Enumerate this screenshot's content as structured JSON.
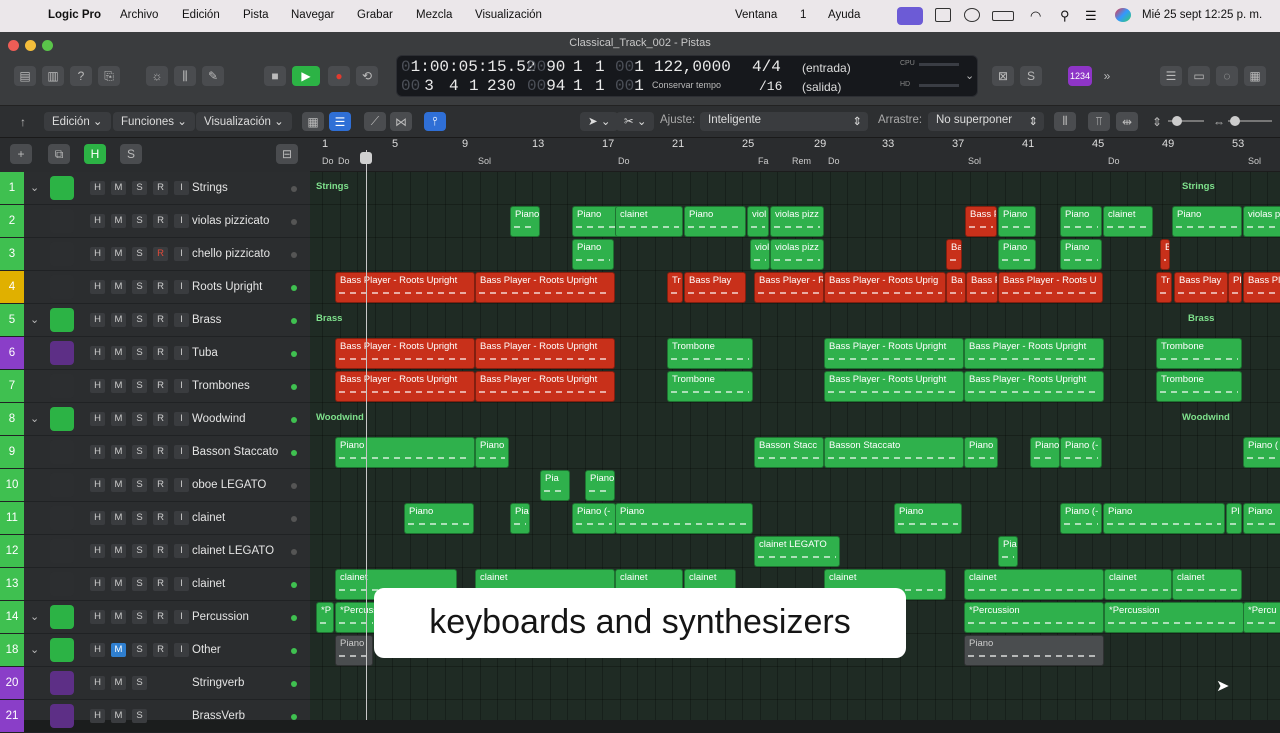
{
  "menubar": {
    "app": "Logic Pro",
    "items": [
      "Archivo",
      "Edición",
      "Pista",
      "Navegar",
      "Grabar",
      "Mezcla",
      "Visualización"
    ],
    "right_items": [
      "Ventana",
      "1",
      "Ayuda"
    ],
    "clock": "Mié 25 sept  12:25 p. m."
  },
  "window": {
    "title": "Classical_Track_002 - Pistas"
  },
  "lcd": {
    "time_dim": "0",
    "time": "1:00:05:15.52",
    "bars_dim": "00",
    "bars_1": "90",
    "b1": "1",
    "b2": "1",
    "ticks_dim": "00",
    "ticks": "1",
    "pos2_dim": "00",
    "pos2_a": "3",
    "pos2_b": "4",
    "pos2_c": "1",
    "pos2_d": "230",
    "end_dim": "00",
    "end_a": "94",
    "end_b": "1",
    "end_c": "1",
    "end_tdim": "00",
    "end_t": "1",
    "tempo": "122,0000",
    "tempo_label": "Conservar tempo",
    "sig": "4/4",
    "div": "/16",
    "in": "(entrada)",
    "out": "(salida)",
    "cpu": "CPU",
    "hd": "HD",
    "badge": "1234"
  },
  "control": {
    "edit": "Edición",
    "functions": "Funciones",
    "view": "Visualización",
    "snap_label": "Ajuste:",
    "snap": "Inteligente",
    "drag_label": "Arrastre:",
    "drag": "No superponer"
  },
  "track_header": {
    "h": "H",
    "s": "S"
  },
  "tracks": [
    {
      "num": "1",
      "name": "Strings",
      "folder": true,
      "color": "#3fc050",
      "led": "#555"
    },
    {
      "num": "2",
      "name": "violas pizzicato",
      "color": "#3fc050",
      "led": "#555"
    },
    {
      "num": "3",
      "name": "chello pizzicato",
      "color": "#3fc050",
      "led": "#555"
    },
    {
      "num": "4",
      "name": "Roots Upright",
      "color": "#e0b000",
      "led": "#3fc050"
    },
    {
      "num": "5",
      "name": "Brass",
      "folder": true,
      "color": "#3fc050",
      "led": "#3fc050"
    },
    {
      "num": "6",
      "name": "Tuba",
      "color": "#8a3ec8",
      "led": "#3fc050"
    },
    {
      "num": "7",
      "name": "Trombones",
      "color": "#3fc050",
      "led": "#3fc050"
    },
    {
      "num": "8",
      "name": "Woodwind",
      "folder": true,
      "color": "#3fc050",
      "led": "#3fc050"
    },
    {
      "num": "9",
      "name": "Basson Staccato",
      "color": "#3fc050",
      "led": "#3fc050"
    },
    {
      "num": "10",
      "name": "oboe LEGATO",
      "color": "#3fc050",
      "led": "#555"
    },
    {
      "num": "11",
      "name": "clainet",
      "color": "#3fc050",
      "led": "#555"
    },
    {
      "num": "12",
      "name": "clainet LEGATO",
      "color": "#3fc050",
      "led": "#555"
    },
    {
      "num": "13",
      "name": "clainet",
      "color": "#3fc050",
      "led": "#3fc050"
    },
    {
      "num": "14",
      "name": "Percussion",
      "folder": true,
      "color": "#3fc050",
      "led": "#3fc050"
    },
    {
      "num": "18",
      "name": "Other",
      "folder": true,
      "color": "#3fc050",
      "led": "#3fc050"
    },
    {
      "num": "20",
      "name": "Stringverb",
      "color": "#8a3ec8",
      "led": "#3fc050"
    },
    {
      "num": "21",
      "name": "BrassVerb",
      "color": "#8a3ec8",
      "led": "#3fc050"
    }
  ],
  "ruler": {
    "bars": [
      "1",
      "5",
      "9",
      "13",
      "17",
      "21",
      "25",
      "29",
      "33",
      "37",
      "41",
      "45",
      "49",
      "53"
    ],
    "chords": [
      "Do",
      "Do",
      "Sol",
      "Do",
      "Fa",
      "Rem",
      "Do",
      "Sol",
      "Do",
      "Sol"
    ]
  },
  "folder_labels": {
    "strings": "Strings",
    "brass": "Brass",
    "woodwind": "Woodwind"
  },
  "regions": {
    "piano": "Piano",
    "clainet": "clainet",
    "viol": "viol",
    "violas": "violas pizz",
    "bass": "Bass Player - Roots Upright",
    "bass_short": "Bass Play",
    "bass_p": "Bass P",
    "bass_u": "Bass Player - Roots U",
    "bass_up": "Bass Player - Roots Uprig",
    "tr": "Tr",
    "ba": "Ba",
    "pl": "Pl",
    "trombone": "Trombone",
    "basson": "Basson Staccato",
    "basson_s": "Basson Stacc",
    "piano_p": "Piano (-",
    "pia": "Pia",
    "pl2": "Pl",
    "clainet_legato": "clainet LEGATO",
    "perc": "*Percussion",
    "perc_s": "*P",
    "perc_t": "*Percu",
    "violas_short": "violas p",
    "bass_pl": "Bass Pl",
    "piano_s": "Piano (",
    "ba2": "Ba"
  },
  "subtitle": "keyboards and synthesizers"
}
